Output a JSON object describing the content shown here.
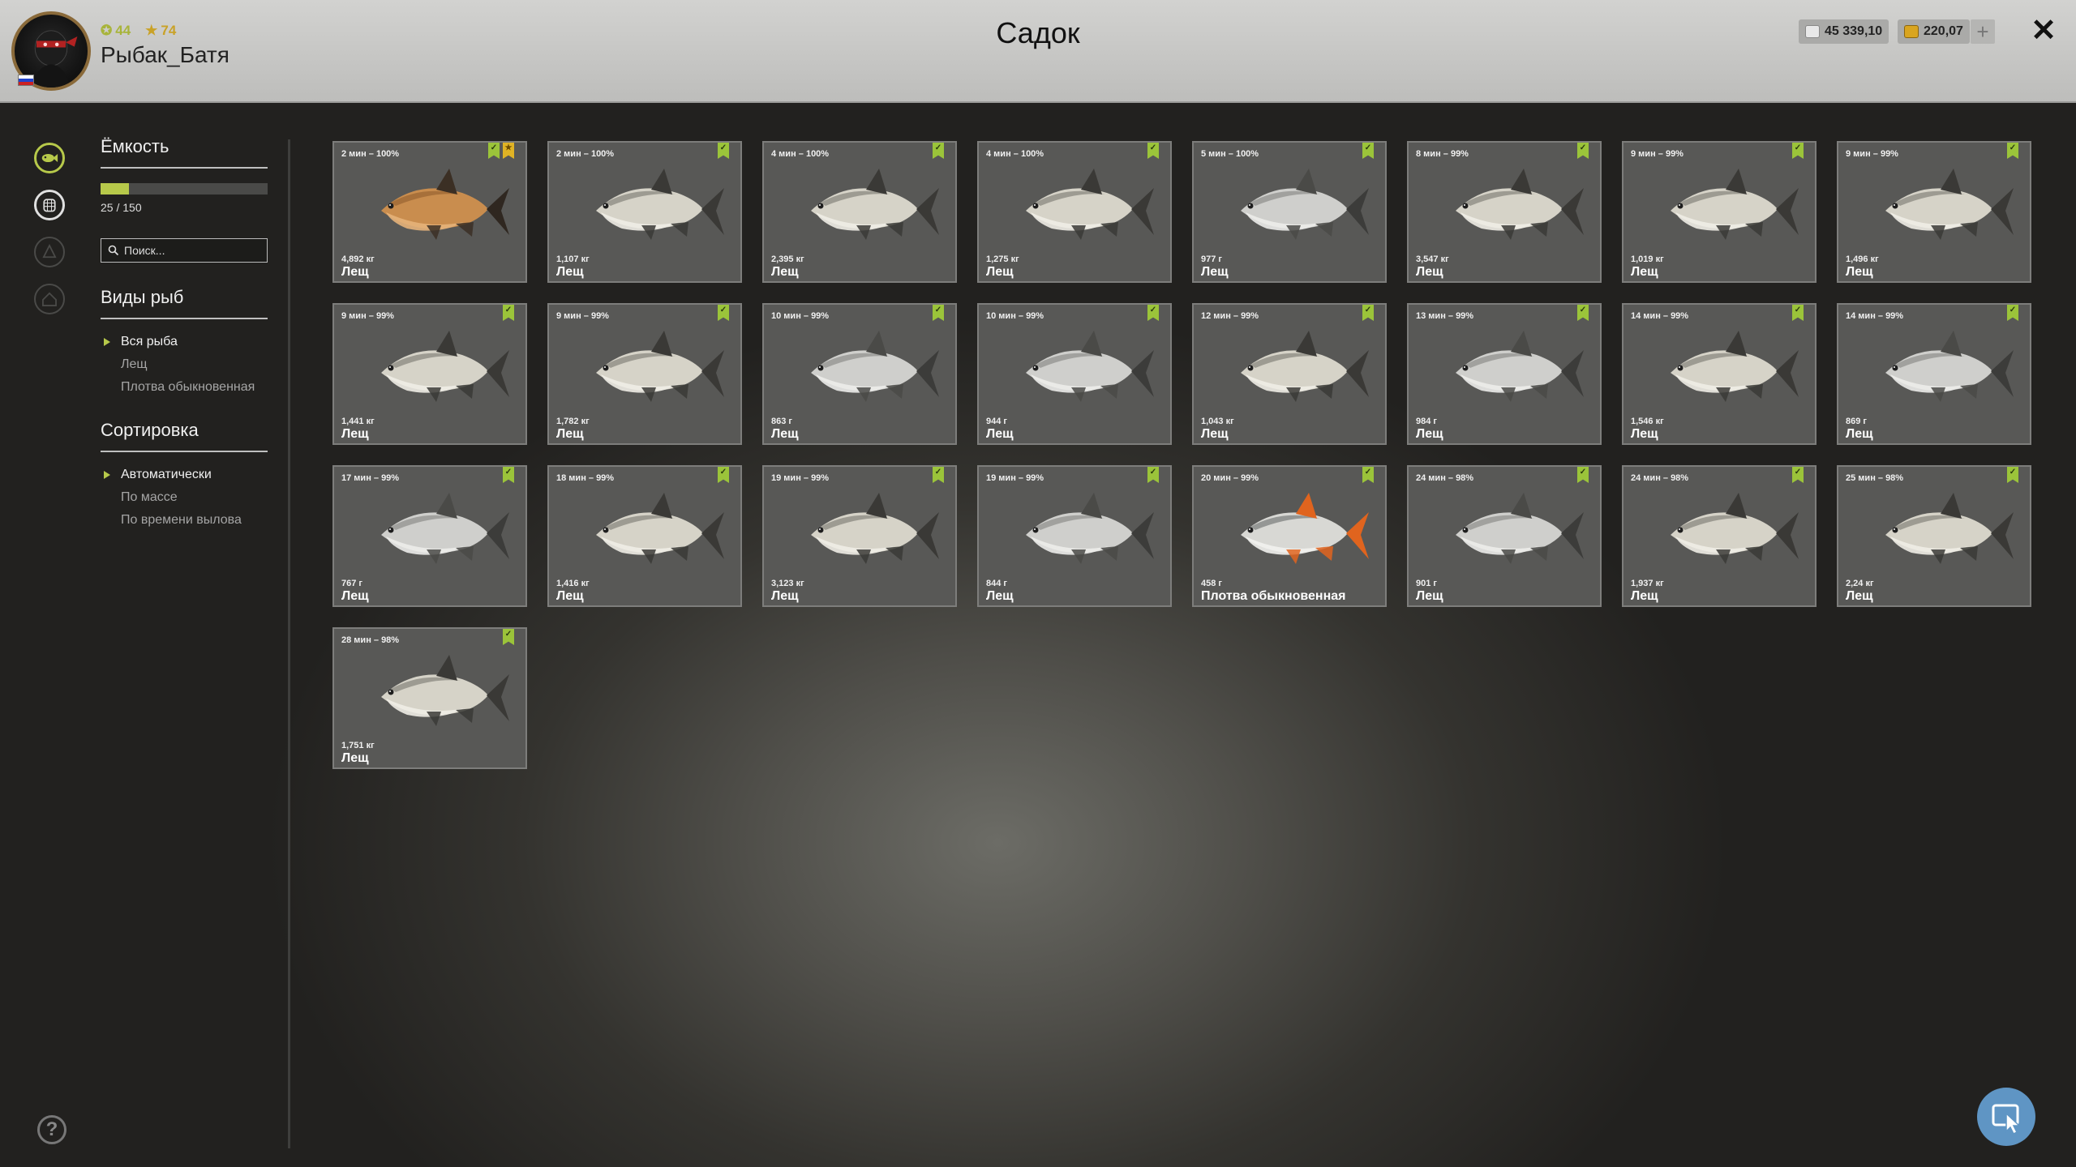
{
  "header": {
    "title": "Садок",
    "username": "Рыбак_Батя",
    "level": "44",
    "rank": "74",
    "silver": "45 339,10",
    "gold": "220,07",
    "plus_label": "+",
    "close_label": "✕"
  },
  "panel": {
    "capacity_title": "Ёмкость",
    "capacity_text": "25 / 150",
    "capacity_fill": 0.17,
    "search_placeholder": "Поиск...",
    "species_title": "Виды рыб",
    "species": [
      "Вся рыба",
      "Лещ",
      "Плотва обыкновенная"
    ],
    "sort_title": "Сортировка",
    "sort": [
      "Автоматически",
      "По массе",
      "По времени вылова"
    ]
  },
  "help_label": "?",
  "colors": {
    "accent": "#b7c94a",
    "bookmark_green": "#9bc43a",
    "bookmark_gold": "#e0b325",
    "fab": "#5f95c4"
  },
  "fish": [
    {
      "time": "2 мин – 100%",
      "weight": "4,892 кг",
      "name": "Лещ",
      "type": "golden-bream",
      "gold": true
    },
    {
      "time": "2 мин – 100%",
      "weight": "1,107 кг",
      "name": "Лещ",
      "type": "bream"
    },
    {
      "time": "4 мин – 100%",
      "weight": "2,395 кг",
      "name": "Лещ",
      "type": "bream"
    },
    {
      "time": "4 мин – 100%",
      "weight": "1,275 кг",
      "name": "Лещ",
      "type": "bream"
    },
    {
      "time": "5 мин – 100%",
      "weight": "977 г",
      "name": "Лещ",
      "type": "silver-bream"
    },
    {
      "time": "8 мин – 99%",
      "weight": "3,547 кг",
      "name": "Лещ",
      "type": "bream"
    },
    {
      "time": "9 мин – 99%",
      "weight": "1,019 кг",
      "name": "Лещ",
      "type": "bream"
    },
    {
      "time": "9 мин – 99%",
      "weight": "1,496 кг",
      "name": "Лещ",
      "type": "bream"
    },
    {
      "time": "9 мин – 99%",
      "weight": "1,441 кг",
      "name": "Лещ",
      "type": "bream"
    },
    {
      "time": "9 мин – 99%",
      "weight": "1,782 кг",
      "name": "Лещ",
      "type": "bream"
    },
    {
      "time": "10 мин – 99%",
      "weight": "863 г",
      "name": "Лещ",
      "type": "silver-bream"
    },
    {
      "time": "10 мин – 99%",
      "weight": "944 г",
      "name": "Лещ",
      "type": "silver-bream"
    },
    {
      "time": "12 мин – 99%",
      "weight": "1,043 кг",
      "name": "Лещ",
      "type": "bream"
    },
    {
      "time": "13 мин – 99%",
      "weight": "984 г",
      "name": "Лещ",
      "type": "silver-bream"
    },
    {
      "time": "14 мин – 99%",
      "weight": "1,546 кг",
      "name": "Лещ",
      "type": "bream"
    },
    {
      "time": "14 мин – 99%",
      "weight": "869 г",
      "name": "Лещ",
      "type": "silver-bream"
    },
    {
      "time": "17 мин – 99%",
      "weight": "767 г",
      "name": "Лещ",
      "type": "silver-bream"
    },
    {
      "time": "18 мин – 99%",
      "weight": "1,416 кг",
      "name": "Лещ",
      "type": "bream"
    },
    {
      "time": "19 мин – 99%",
      "weight": "3,123 кг",
      "name": "Лещ",
      "type": "bream"
    },
    {
      "time": "19 мин – 99%",
      "weight": "844 г",
      "name": "Лещ",
      "type": "silver-bream"
    },
    {
      "time": "20 мин – 99%",
      "weight": "458 г",
      "name": "Плотва обыкновенная",
      "type": "roach"
    },
    {
      "time": "24 мин – 98%",
      "weight": "901 г",
      "name": "Лещ",
      "type": "silver-bream"
    },
    {
      "time": "24 мин – 98%",
      "weight": "1,937 кг",
      "name": "Лещ",
      "type": "bream"
    },
    {
      "time": "25 мин – 98%",
      "weight": "2,24 кг",
      "name": "Лещ",
      "type": "bream"
    },
    {
      "time": "28 мин – 98%",
      "weight": "1,751 кг",
      "name": "Лещ",
      "type": "bream"
    }
  ]
}
